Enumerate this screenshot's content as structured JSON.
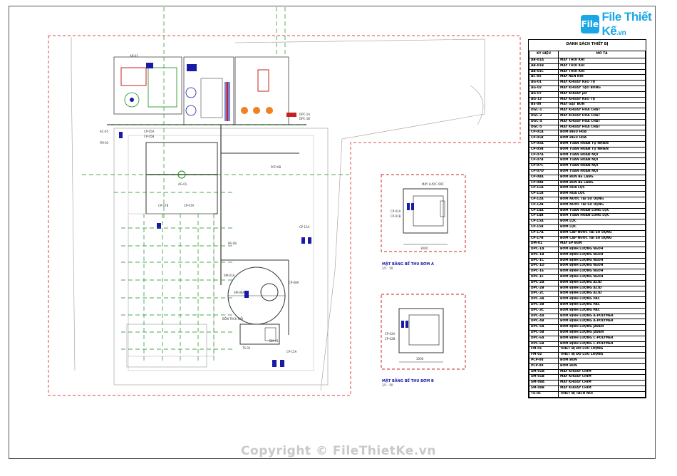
{
  "logo": {
    "brand": "File Thiết Kế",
    "suffix": ".vn",
    "icon_text": "File"
  },
  "equipment_table": {
    "title": "DANH SÁCH THIẾT BỊ",
    "headers": [
      "KÝ HIỆU",
      "MÔ TẢ"
    ],
    "rows": [
      [
        "AB-01A",
        "MÁY THỔI KHÍ"
      ],
      [
        "AB-01B",
        "MÁY THỔI KHÍ"
      ],
      [
        "AB-01C",
        "MÁY THỔI KHÍ"
      ],
      [
        "AC-05",
        "MÁY NÉN KHÍ"
      ],
      [
        "AG-01",
        "MÁY KHUẤY KEO TỤ"
      ],
      [
        "AG-02",
        "MÁY KHUẤY TẠO BÔNG"
      ],
      [
        "AG-07",
        "MÁY KHUẤY pH"
      ],
      [
        "AG-13",
        "MÁY KHUẤY KEO TỤ"
      ],
      [
        "BS-08",
        "MÁY GẠT BÙN"
      ],
      [
        "DGC-1",
        "MÁY KHUẤY HÓA CHẤT"
      ],
      [
        "DGC-2",
        "MÁY KHUẤY HÓA CHẤT"
      ],
      [
        "DGC-4",
        "MÁY KHUẤY HÓA CHẤT"
      ],
      [
        "DGC-5",
        "MÁY KHUẤY HÓA CHẤT"
      ],
      [
        "CP-01A",
        "BƠM ĐIỀU HÒA"
      ],
      [
        "CP-01B",
        "BƠM ĐIỀU HÒA"
      ],
      [
        "CP-05A",
        "BƠM TUẦN HOÀN TỰ NHIÊN"
      ],
      [
        "CP-05B",
        "BƠM TUẦN HOÀN TỰ NHIÊN"
      ],
      [
        "CP-07A",
        "BƠM TUẦN HOÀN NỘI"
      ],
      [
        "CP-07B",
        "BƠM TUẦN HOÀN NỘI"
      ],
      [
        "CP-07C",
        "BƠM TUẦN HOÀN NỘI"
      ],
      [
        "CP-07D",
        "BƠM TUẦN HOÀN NỘI"
      ],
      [
        "CP-08A",
        "BƠM BÙN BỂ LẮNG"
      ],
      [
        "CP-08B",
        "BƠM BÙN BỂ LẮNG"
      ],
      [
        "CP-11A",
        "BƠM RỬA LỌC"
      ],
      [
        "CP-11B",
        "BƠM RỬA LỌC"
      ],
      [
        "CP-12A",
        "BƠM NƯỚC TÁI SỬ DỤNG"
      ],
      [
        "CP-12B",
        "BƠM NƯỚC TÁI SỬ DỤNG"
      ],
      [
        "CP-14A",
        "BƠM TUẦN HOÀN LÒNG LỌC"
      ],
      [
        "CP-14B",
        "BƠM TUẦN HOÀN LÒNG LỌC"
      ],
      [
        "CP-15A",
        "BƠM LỌC"
      ],
      [
        "CP-15B",
        "BƠM LỌC"
      ],
      [
        "CP-17A",
        "BƠM CẤP NƯỚC TÁI SỬ DỤNG"
      ],
      [
        "CP-17B",
        "BƠM CẤP NƯỚC TÁI SỬ DỤNG"
      ],
      [
        "DM-01",
        "MÁY ÉP BÙN"
      ],
      [
        "DPC-1A",
        "BƠM ĐỊNH LƯỢNG NaOH"
      ],
      [
        "DPC-1B",
        "BƠM ĐỊNH LƯỢNG NaOH"
      ],
      [
        "DPC-1C",
        "BƠM ĐỊNH LƯỢNG NaOH"
      ],
      [
        "DPC-1D",
        "BƠM ĐỊNH LƯỢNG NaOH"
      ],
      [
        "DPC-1E",
        "BƠM ĐỊNH LƯỢNG NaOH"
      ],
      [
        "DPC-1F",
        "BƠM ĐỊNH LƯỢNG NaOH"
      ],
      [
        "DPC-2A",
        "BƠM ĐỊNH LƯỢNG ACID"
      ],
      [
        "DPC-2B",
        "BƠM ĐỊNH LƯỢNG ACID"
      ],
      [
        "DPC-2C",
        "BƠM ĐỊNH LƯỢNG ACID"
      ],
      [
        "DPC-3A",
        "BƠM ĐỊNH LƯỢNG PAC"
      ],
      [
        "DPC-3B",
        "BƠM ĐỊNH LƯỢNG PAC"
      ],
      [
        "DPC-3C",
        "BƠM ĐỊNH LƯỢNG PAC"
      ],
      [
        "DPC-4A",
        "BƠM ĐỊNH LƯỢNG A-POLYMER"
      ],
      [
        "DPC-4B",
        "BƠM ĐỊNH LƯỢNG A-POLYMER"
      ],
      [
        "DPC-5A",
        "BƠM ĐỊNH LƯỢNG JAVEN"
      ],
      [
        "DPC-5B",
        "BƠM ĐỊNH LƯỢNG JAVEN"
      ],
      [
        "DPC-6A",
        "BƠM ĐỊNH LƯỢNG C-POLYMER"
      ],
      [
        "DPC-6B",
        "BƠM ĐỊNH LƯỢNG C-POLYMER"
      ],
      [
        "FM-01",
        "THIẾT BỊ ĐO LƯU LƯỢNG"
      ],
      [
        "FM-02",
        "THIẾT BỊ ĐO LƯU LƯỢNG"
      ],
      [
        "PCP-08",
        "BƠM BÙN"
      ],
      [
        "PCP-09",
        "BƠM BÙN"
      ],
      [
        "SM-01A",
        "MÁY KHUẤY CHÌM"
      ],
      [
        "SM-01B",
        "MÁY KHUẤY CHÌM"
      ],
      [
        "SM-08A",
        "MÁY KHUẤY CHÌM"
      ],
      [
        "SM-08B",
        "MÁY KHUẤY CHÌM"
      ],
      [
        "TS-01",
        "THIẾT BỊ TÁCH NỔI"
      ]
    ]
  },
  "detail_a": {
    "title": "MẶT BẰNG BỂ THU BƠM A",
    "scale": "1/1 : 50",
    "tank_label": "MÁY LƯỢC RÁC",
    "pump_labels": [
      "CP-01A",
      "CP-01B"
    ],
    "dim": "3000"
  },
  "detail_b": {
    "title": "MẶT BẰNG BỂ THU BƠM B",
    "scale": "1/1 : 50",
    "pump_labels": [
      "CP-02A",
      "CP-02B"
    ],
    "dim": "3000"
  },
  "plan_labels": {
    "ab": "AB-01",
    "cp05a": "CP-05A",
    "cp05b": "CP-05B",
    "ac": "AC-05",
    "fm": "FM-01",
    "dpc": "DPC-1A",
    "dpc2": "DPC-1B",
    "pcp": "PCP-08",
    "bs": "BS-08",
    "cp12": "CP-12A",
    "cp07": "CP-07B",
    "cp07b": "CP-07A",
    "sm": "SM-01A",
    "sm2": "SM-08A",
    "cp08": "CP-08A",
    "bon": "BỒN TÁCH NỔI",
    "ts": "TS-01",
    "cp15": "CP-15A",
    "dm": "DM-01",
    "ag01": "AG-01"
  },
  "colors": {
    "boundary": "#e04040",
    "pipe": "#1a8a1a",
    "equipment": "#1a1aa8",
    "detail": "#cc2222"
  },
  "watermark": "Copyright © FileThietKe.vn"
}
